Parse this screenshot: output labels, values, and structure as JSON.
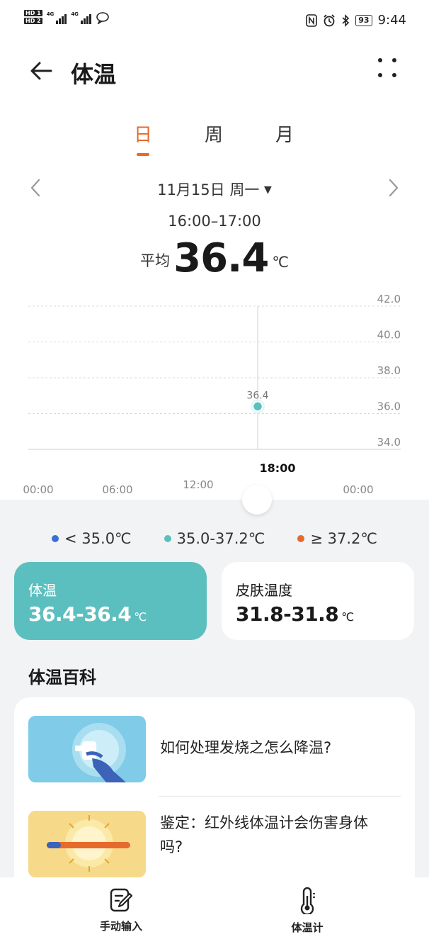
{
  "status_bar": {
    "network": "4G",
    "battery": "93",
    "time": "9:44"
  },
  "header": {
    "title": "体温"
  },
  "tabs": [
    {
      "label": "日",
      "active": true
    },
    {
      "label": "周",
      "active": false
    },
    {
      "label": "月",
      "active": false
    }
  ],
  "date_nav": {
    "date": "11月15日 周一"
  },
  "summary": {
    "time_range": "16:00–17:00",
    "avg_label": "平均",
    "avg_value": "36.4",
    "unit": "℃"
  },
  "chart_data": {
    "type": "scatter",
    "x_tick_labels": [
      "00:00",
      "06:00",
      "12:00",
      "18:00",
      "00:00"
    ],
    "y_ticks": [
      "42.0",
      "40.0",
      "38.0",
      "36.0",
      "34.0"
    ],
    "ylim": [
      34.0,
      42.0
    ],
    "points": [
      {
        "x": "16:30",
        "y": 36.4,
        "label": "36.4"
      }
    ],
    "selected_time": "18:00",
    "grid": true
  },
  "legend": [
    {
      "label": "< 35.0℃",
      "color": "#3b6fd8"
    },
    {
      "label": "35.0-37.2℃",
      "color": "#5bbfbf"
    },
    {
      "label": "≥ 37.2℃",
      "color": "#e56a2c"
    }
  ],
  "cards": {
    "body_temp": {
      "title": "体温",
      "value": "36.4-36.4",
      "unit": "℃"
    },
    "skin_temp": {
      "title": "皮肤温度",
      "value": "31.8-31.8",
      "unit": "℃"
    }
  },
  "encyclopedia": {
    "title": "体温百科",
    "articles": [
      {
        "title": "如何处理发烧之怎么降温?"
      },
      {
        "title_line1": "鉴定：红外线体温计会伤害身体",
        "title_line2": "吗?"
      }
    ]
  },
  "navbar": {
    "manual": "手动输入",
    "thermometer": "体温计"
  },
  "colors": {
    "accent": "#e56a2c",
    "teal": "#5bbfbf"
  }
}
